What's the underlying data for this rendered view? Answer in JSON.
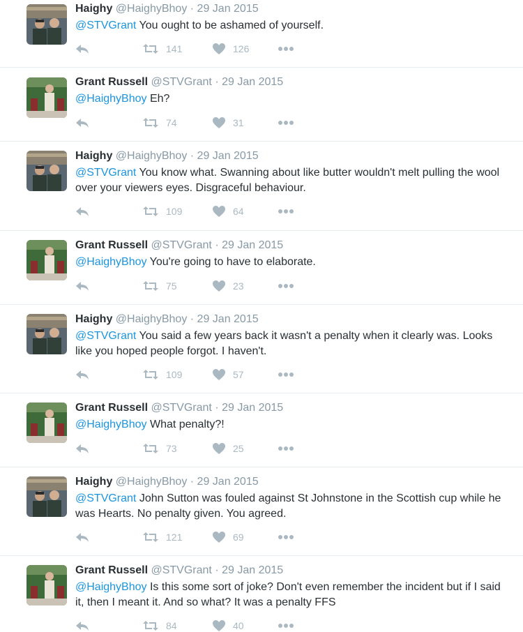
{
  "tweets": [
    {
      "name": "Haighy",
      "handle": "@HaighyBhoy",
      "date": "29 Jan 2015",
      "mention": "@STVGrant",
      "text": " You ought to be ashamed of yourself.",
      "retweets": "141",
      "likes": "126",
      "avatar": "haighy"
    },
    {
      "name": "Grant Russell",
      "handle": "@STVGrant",
      "date": "29 Jan 2015",
      "mention": "@HaighyBhoy",
      "text": " Eh?",
      "retweets": "74",
      "likes": "31",
      "avatar": "grant"
    },
    {
      "name": "Haighy",
      "handle": "@HaighyBhoy",
      "date": "29 Jan 2015",
      "mention": "@STVGrant",
      "text": " You know what. Swanning about like butter wouldn't melt pulling the wool over your viewers eyes. Disgraceful behaviour.",
      "retweets": "109",
      "likes": "64",
      "avatar": "haighy"
    },
    {
      "name": "Grant Russell",
      "handle": "@STVGrant",
      "date": "29 Jan 2015",
      "mention": "@HaighyBhoy",
      "text": " You're going to have to elaborate.",
      "retweets": "75",
      "likes": "23",
      "avatar": "grant"
    },
    {
      "name": "Haighy",
      "handle": "@HaighyBhoy",
      "date": "29 Jan 2015",
      "mention": "@STVGrant",
      "text": " You said a few years back it wasn't a penalty when it clearly was. Looks like you hoped people forgot. I haven't.",
      "retweets": "109",
      "likes": "57",
      "avatar": "haighy"
    },
    {
      "name": "Grant Russell",
      "handle": "@STVGrant",
      "date": "29 Jan 2015",
      "mention": "@HaighyBhoy",
      "text": " What penalty?!",
      "retweets": "73",
      "likes": "25",
      "avatar": "grant"
    },
    {
      "name": "Haighy",
      "handle": "@HaighyBhoy",
      "date": "29 Jan 2015",
      "mention": "@STVGrant",
      "text": " John Sutton was fouled against St Johnstone in the Scottish cup while he was Hearts. No penalty given. You agreed.",
      "retweets": "121",
      "likes": "69",
      "avatar": "haighy"
    },
    {
      "name": "Grant Russell",
      "handle": "@STVGrant",
      "date": "29 Jan 2015",
      "mention": "@HaighyBhoy",
      "text": " Is this some sort of joke? Don't even remember the incident but if I said it, then I meant it. And so what? It was a penalty FFS",
      "retweets": "84",
      "likes": "40",
      "avatar": "grant"
    }
  ],
  "separator": "·",
  "colors": {
    "mention": "#1b95e0",
    "meta": "#8899a6",
    "icon": "#aab8c2",
    "border": "#e6ecf0"
  },
  "icons": {
    "reply": "reply-icon",
    "retweet": "retweet-icon",
    "like": "heart-icon",
    "more": "more-dots-icon"
  }
}
